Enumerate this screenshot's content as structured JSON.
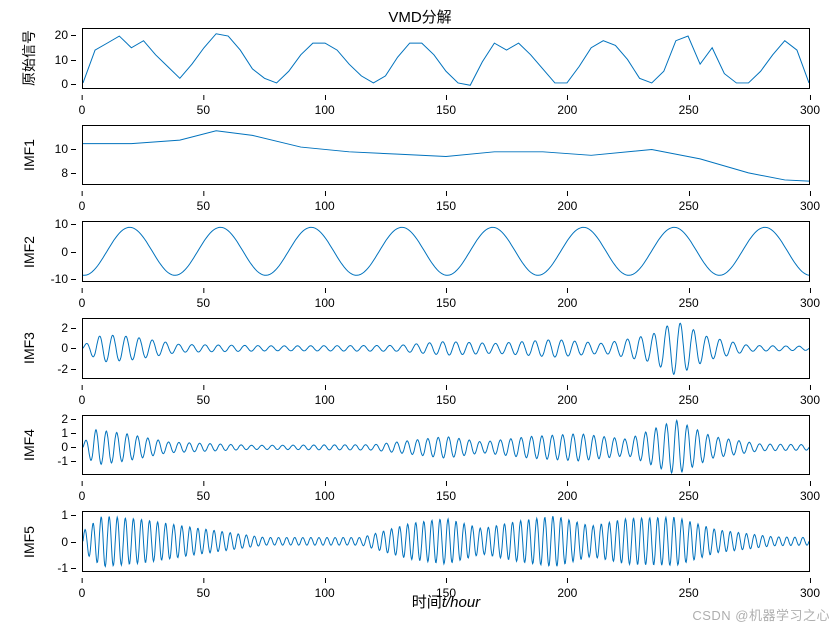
{
  "title": "VMD分解",
  "xlabel_prefix": "时间",
  "xlabel_var": "t",
  "xlabel_unit": "/hour",
  "watermark": "CSDN @机器学习之心",
  "line_color": "#0072BD",
  "panels": [
    {
      "ylabel": "原始信号",
      "yticks": [
        0,
        10,
        20
      ],
      "xticks": [
        0,
        50,
        100,
        150,
        200,
        250,
        300
      ]
    },
    {
      "ylabel": "IMF1",
      "yticks": [
        8,
        10
      ],
      "xticks": [
        0,
        50,
        100,
        150,
        200,
        250,
        300
      ]
    },
    {
      "ylabel": "IMF2",
      "yticks": [
        -10,
        0,
        10
      ],
      "xticks": [
        0,
        50,
        100,
        150,
        200,
        250,
        300
      ]
    },
    {
      "ylabel": "IMF3",
      "yticks": [
        -2,
        0,
        2
      ],
      "xticks": [
        0,
        50,
        100,
        150,
        200,
        250,
        300
      ]
    },
    {
      "ylabel": "IMF4",
      "yticks": [
        -1,
        0,
        1,
        2
      ],
      "xticks": [
        0,
        50,
        100,
        150,
        200,
        250,
        300
      ]
    },
    {
      "ylabel": "IMF5",
      "yticks": [
        -1,
        0,
        1
      ],
      "xticks": [
        0,
        50,
        100,
        150,
        200,
        250,
        300
      ]
    }
  ],
  "chart_data": [
    {
      "type": "line",
      "title": "VMD分解",
      "ylabel": "原始信号",
      "xlim": [
        0,
        300
      ],
      "ylim": [
        -2,
        23
      ],
      "xticks": [
        0,
        50,
        100,
        150,
        200,
        250,
        300
      ],
      "yticks": [
        0,
        10,
        20
      ],
      "approx_series": {
        "x": [
          0,
          5,
          10,
          15,
          20,
          25,
          30,
          35,
          40,
          45,
          50,
          55,
          60,
          65,
          70,
          75,
          80,
          85,
          90,
          95,
          100,
          105,
          110,
          115,
          120,
          125,
          130,
          135,
          140,
          145,
          150,
          155,
          160,
          165,
          170,
          175,
          180,
          185,
          190,
          195,
          200,
          205,
          210,
          215,
          220,
          225,
          230,
          235,
          240,
          245,
          250,
          255,
          260,
          265,
          270,
          275,
          280,
          285,
          290,
          295,
          300
        ],
        "y": [
          0,
          14,
          17,
          20,
          15,
          18,
          12,
          7,
          2,
          8,
          15,
          21,
          20,
          14,
          6,
          2,
          0,
          5,
          12,
          17,
          17,
          14,
          8,
          3,
          0,
          3,
          11,
          17,
          17,
          12,
          5,
          0,
          -1,
          9,
          17,
          14,
          17,
          12,
          6,
          0,
          0,
          7,
          15,
          18,
          16,
          10,
          2,
          0,
          5,
          18,
          20,
          8,
          15,
          4,
          0,
          0,
          5,
          12,
          18,
          14,
          0
        ]
      }
    },
    {
      "type": "line",
      "ylabel": "IMF1",
      "xlim": [
        0,
        300
      ],
      "ylim": [
        7,
        12
      ],
      "xticks": [
        0,
        50,
        100,
        150,
        200,
        250,
        300
      ],
      "yticks": [
        8,
        10
      ],
      "approx_series": {
        "x": [
          0,
          20,
          40,
          55,
          70,
          90,
          110,
          130,
          150,
          170,
          190,
          210,
          235,
          255,
          275,
          290,
          300
        ],
        "y": [
          10.5,
          10.5,
          10.8,
          11.6,
          11.2,
          10.2,
          9.8,
          9.6,
          9.4,
          9.8,
          9.8,
          9.5,
          10.0,
          9.2,
          8.0,
          7.4,
          7.3
        ]
      }
    },
    {
      "type": "line",
      "ylabel": "IMF2",
      "xlim": [
        0,
        300
      ],
      "ylim": [
        -11,
        11
      ],
      "xticks": [
        0,
        50,
        100,
        150,
        200,
        250,
        300
      ],
      "yticks": [
        -10,
        0,
        10
      ],
      "approx_sine": {
        "freq_cycles": 8,
        "amp": 9,
        "phase_deg": -95
      }
    },
    {
      "type": "line",
      "ylabel": "IMF3",
      "xlim": [
        0,
        300
      ],
      "ylim": [
        -3,
        3
      ],
      "xticks": [
        0,
        50,
        100,
        150,
        200,
        250,
        300
      ],
      "yticks": [
        -2,
        0,
        2
      ],
      "approx_modulated": {
        "carrier_cycles": 55,
        "envelope": [
          {
            "x": 0,
            "a": 0.3
          },
          {
            "x": 8,
            "a": 1.4
          },
          {
            "x": 20,
            "a": 1.2
          },
          {
            "x": 40,
            "a": 0.4
          },
          {
            "x": 80,
            "a": 0.25
          },
          {
            "x": 130,
            "a": 0.3
          },
          {
            "x": 150,
            "a": 0.7
          },
          {
            "x": 170,
            "a": 0.5
          },
          {
            "x": 195,
            "a": 0.9
          },
          {
            "x": 215,
            "a": 0.5
          },
          {
            "x": 235,
            "a": 1.4
          },
          {
            "x": 245,
            "a": 2.8
          },
          {
            "x": 258,
            "a": 1.2
          },
          {
            "x": 275,
            "a": 0.3
          },
          {
            "x": 300,
            "a": 0.2
          }
        ]
      }
    },
    {
      "type": "line",
      "ylabel": "IMF4",
      "xlim": [
        0,
        300
      ],
      "ylim": [
        -2,
        2.3
      ],
      "xticks": [
        0,
        50,
        100,
        150,
        200,
        250,
        300
      ],
      "yticks": [
        -1,
        0,
        1,
        2
      ],
      "approx_modulated": {
        "carrier_cycles": 70,
        "envelope": [
          {
            "x": 0,
            "a": 0.3
          },
          {
            "x": 5,
            "a": 1.3
          },
          {
            "x": 18,
            "a": 1.0
          },
          {
            "x": 35,
            "a": 0.4
          },
          {
            "x": 70,
            "a": 0.15
          },
          {
            "x": 120,
            "a": 0.2
          },
          {
            "x": 150,
            "a": 0.8
          },
          {
            "x": 165,
            "a": 0.4
          },
          {
            "x": 185,
            "a": 0.8
          },
          {
            "x": 205,
            "a": 1.0
          },
          {
            "x": 225,
            "a": 0.6
          },
          {
            "x": 245,
            "a": 2.0
          },
          {
            "x": 260,
            "a": 0.8
          },
          {
            "x": 280,
            "a": 0.25
          },
          {
            "x": 300,
            "a": 0.2
          }
        ]
      }
    },
    {
      "type": "line",
      "ylabel": "IMF5",
      "xlim": [
        0,
        300
      ],
      "ylim": [
        -1.15,
        1.15
      ],
      "xticks": [
        0,
        50,
        100,
        150,
        200,
        250,
        300
      ],
      "yticks": [
        -1,
        0,
        1
      ],
      "approx_modulated": {
        "carrier_cycles": 90,
        "envelope": [
          {
            "x": 0,
            "a": 0.4
          },
          {
            "x": 8,
            "a": 1.0
          },
          {
            "x": 25,
            "a": 0.85
          },
          {
            "x": 45,
            "a": 0.55
          },
          {
            "x": 75,
            "a": 0.15
          },
          {
            "x": 115,
            "a": 0.15
          },
          {
            "x": 135,
            "a": 0.7
          },
          {
            "x": 150,
            "a": 0.9
          },
          {
            "x": 165,
            "a": 0.5
          },
          {
            "x": 180,
            "a": 0.8
          },
          {
            "x": 195,
            "a": 1.0
          },
          {
            "x": 210,
            "a": 0.6
          },
          {
            "x": 225,
            "a": 0.9
          },
          {
            "x": 245,
            "a": 0.95
          },
          {
            "x": 262,
            "a": 0.45
          },
          {
            "x": 285,
            "a": 0.18
          },
          {
            "x": 300,
            "a": 0.15
          }
        ]
      }
    }
  ]
}
